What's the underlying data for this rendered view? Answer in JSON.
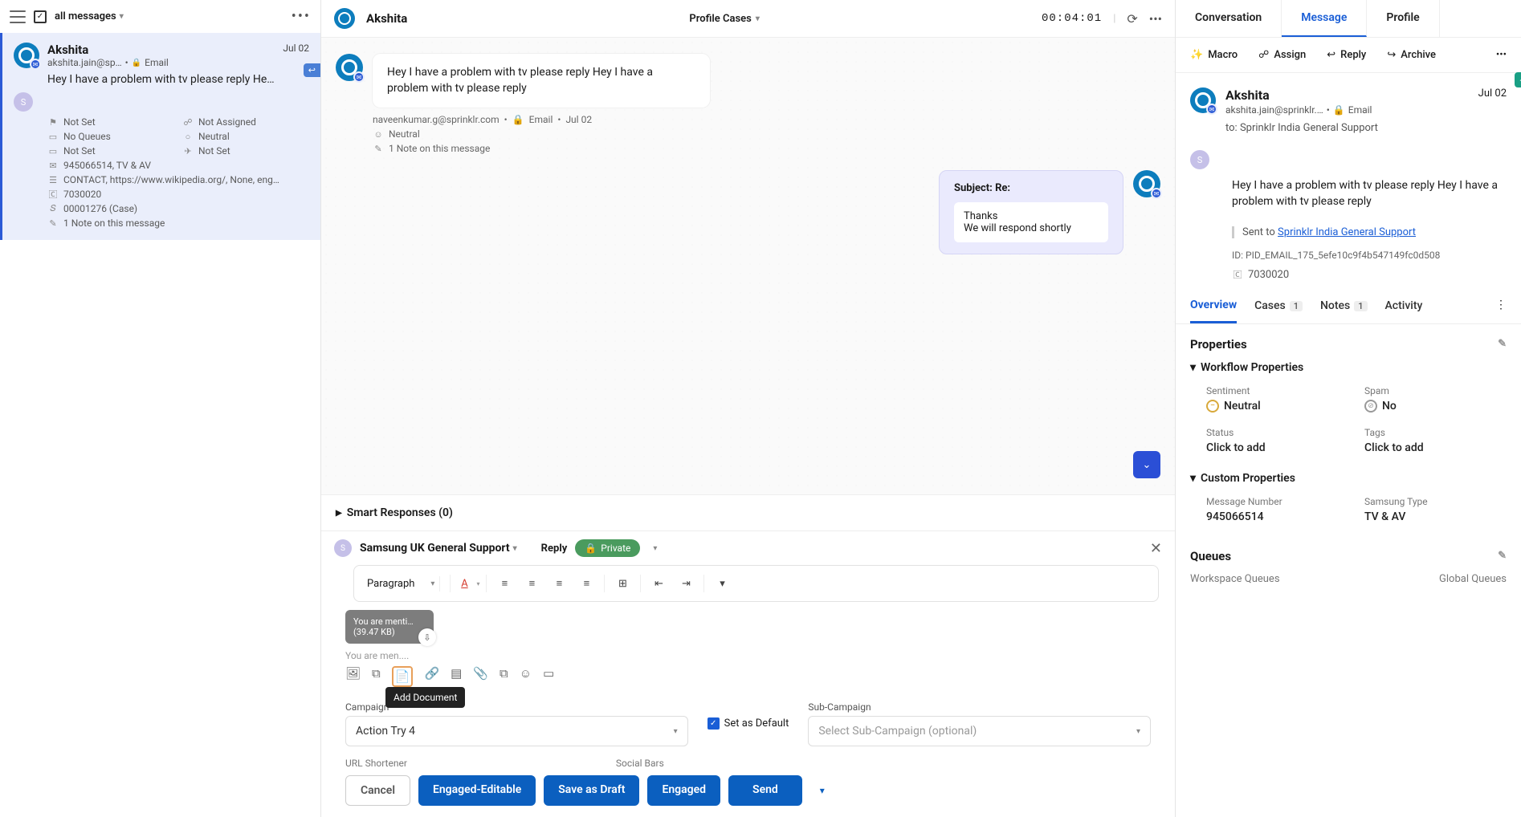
{
  "leftHeader": {
    "allMessages": "all messages"
  },
  "card": {
    "name": "Akshita",
    "date": "Jul 02",
    "email": "akshita.jain@sp…",
    "channel": "Email",
    "preview": "Hey I have a problem with tv please reply He…",
    "meta": {
      "notSet1": "Not Set",
      "notAssigned": "Not Assigned",
      "noQueues": "No Queues",
      "neutral": "Neutral",
      "notSet2": "Not Set",
      "notSet3": "Not Set",
      "msgNum": "945066514, TV & AV",
      "contact": "CONTACT, https://www.wikipedia.org/, None, eng…",
      "casenum": "7030020",
      "caseid": "00001276 (Case)",
      "note": "1 Note on this message"
    }
  },
  "center": {
    "name": "Akshita",
    "profileCases": "Profile Cases",
    "timer": "00:04:01",
    "bubbleText": "Hey I have a problem with tv please reply Hey I have a problem with tv please reply",
    "metaLine": "naveenkumar.g@sprinklr.com",
    "metaChannel": "Email",
    "metaDate": "Jul 02",
    "metaSent": "Neutral",
    "metaNote": "1 Note on this message",
    "replySubject": "Subject: Re:",
    "replyLine1": "Thanks",
    "replyLine2": "We will respond shortly",
    "smartResp": "Smart Responses (0)"
  },
  "compose": {
    "from": "Samsung UK General Support",
    "reply": "Reply",
    "private": "Private",
    "paragraph": "Paragraph",
    "attachName": "You are menti…",
    "attachSize": "(39.47 KB)",
    "mentionLine": "You are men....",
    "tooltip": "Add Document",
    "campaignLabel": "Campaign",
    "setDefault": "Set as Default",
    "subCampaignLabel": "Sub-Campaign",
    "campaignVal": "Action Try 4",
    "subCampaignPh": "Select Sub-Campaign (optional)",
    "urlShort": "URL Shortener",
    "socialBars": "Social Bars",
    "btnCancel": "Cancel",
    "btnEngEdit": "Engaged-Editable",
    "btnDraft": "Save as Draft",
    "btnEngaged": "Engaged",
    "btnSend": "Send"
  },
  "right": {
    "tabs": {
      "conversation": "Conversation",
      "message": "Message",
      "profile": "Profile"
    },
    "actions": {
      "macro": "Macro",
      "assign": "Assign",
      "reply": "Reply",
      "archive": "Archive"
    },
    "name": "Akshita",
    "email": "akshita.jain@sprinklr.…",
    "channel": "Email",
    "date": "Jul 02",
    "toLabel": "to:",
    "to": "Sprinklr India General Support",
    "body": "Hey I have a problem with tv please reply Hey I have a problem with tv please reply",
    "sentPrefix": "Sent to ",
    "sentLink": "Sprinklr India General Support",
    "id": "ID: PID_EMAIL_175_5efe10c9f4b547149fc0d508",
    "caseNum": "7030020",
    "subtabs": {
      "overview": "Overview",
      "cases": "Cases",
      "casesCount": "1",
      "notes": "Notes",
      "notesCount": "1",
      "activity": "Activity"
    },
    "propsHeader": "Properties",
    "workflowHeader": "Workflow Properties",
    "sentimentLabel": "Sentiment",
    "sentimentVal": "Neutral",
    "spamLabel": "Spam",
    "spamVal": "No",
    "statusLabel": "Status",
    "statusVal": "Click to add",
    "tagsLabel": "Tags",
    "tagsVal": "Click to add",
    "customHeader": "Custom Properties",
    "msgNumLabel": "Message Number",
    "msgNumVal": "945066514",
    "samsungLabel": "Samsung Type",
    "samsungVal": "TV & AV",
    "queuesHeader": "Queues",
    "workspaceQ": "Workspace Queues",
    "globalQ": "Global Queues"
  }
}
